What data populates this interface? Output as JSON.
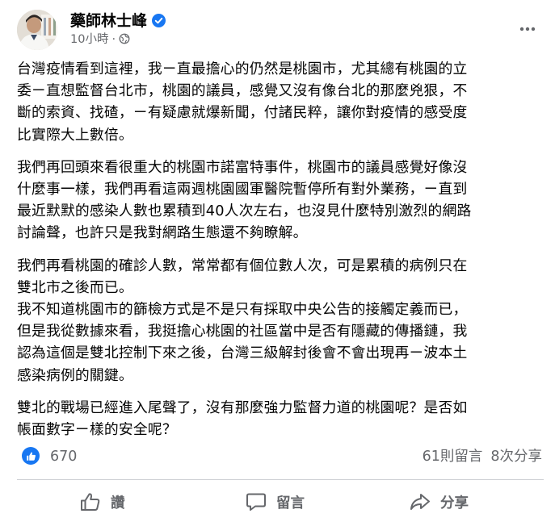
{
  "author": {
    "name": "藥師林士峰",
    "verified_icon": "verified-badge-icon",
    "avatar_icon": "profile-photo"
  },
  "post_meta": {
    "time": "10小時",
    "separator": "·",
    "audience_icon": "globe-icon"
  },
  "more_icon": "more-options-icon",
  "paragraphs": [
    {
      "lines": [
        "台灣疫情看到這裡，我ㄧ直最擔心的仍然是桃園市，尤其總有桃園的立",
        "委ㄧ直想監督台北市，桃園的議員，感覺又沒有像台北的那麼兇狠，不",
        "斷的索資、找碴，ㄧ有疑慮就爆新聞，付諸民粹，讓你對疫情的感受度",
        "比實際大上數倍。"
      ]
    },
    {
      "lines": [
        "我們再回頭來看很重大的桃園市諾富特事件，桃園市的議員感覺好像沒",
        "什麼事一樣，我們再看這兩週桃園國軍醫院暫停所有對外業務，ㄧ直到",
        "最近默默的感染人數也累積到40人次左右，也沒見什麼特別激烈的網路",
        "討論聲，也許只是我對網路生態還不夠瞭解。"
      ]
    },
    {
      "lines": [
        "我們再看桃園的確診人數，常常都有個位數人次，可是累積的病例只在",
        "雙北市之後而已。",
        "我不知道桃園市的篩檢方式是不是只有採取中央公告的接觸定義而已，",
        "但是我從數據來看，我挺擔心桃園的社區當中是否有隱藏的傳播鏈，我",
        "認為這個是雙北控制下來之後，台灣三級解封後會不會出現再ㄧ波本土",
        "感染病例的關鍵。"
      ]
    },
    {
      "lines": [
        "雙北的戰場已經進入尾聲了，沒有那麼強力監督力道的桃園呢？是否如",
        "帳面數字ㄧ樣的安全呢？"
      ]
    }
  ],
  "stats": {
    "likes": "670",
    "comments": "61則留言",
    "shares": "8次分享",
    "like_badge_icon": "thumbs-up-badge-icon"
  },
  "actions": {
    "like": "讚",
    "comment": "留言",
    "share": "分享"
  },
  "colors": {
    "text": "#050505",
    "secondary": "#65676b",
    "accent": "#1877f2",
    "divider": "#ced0d4"
  }
}
